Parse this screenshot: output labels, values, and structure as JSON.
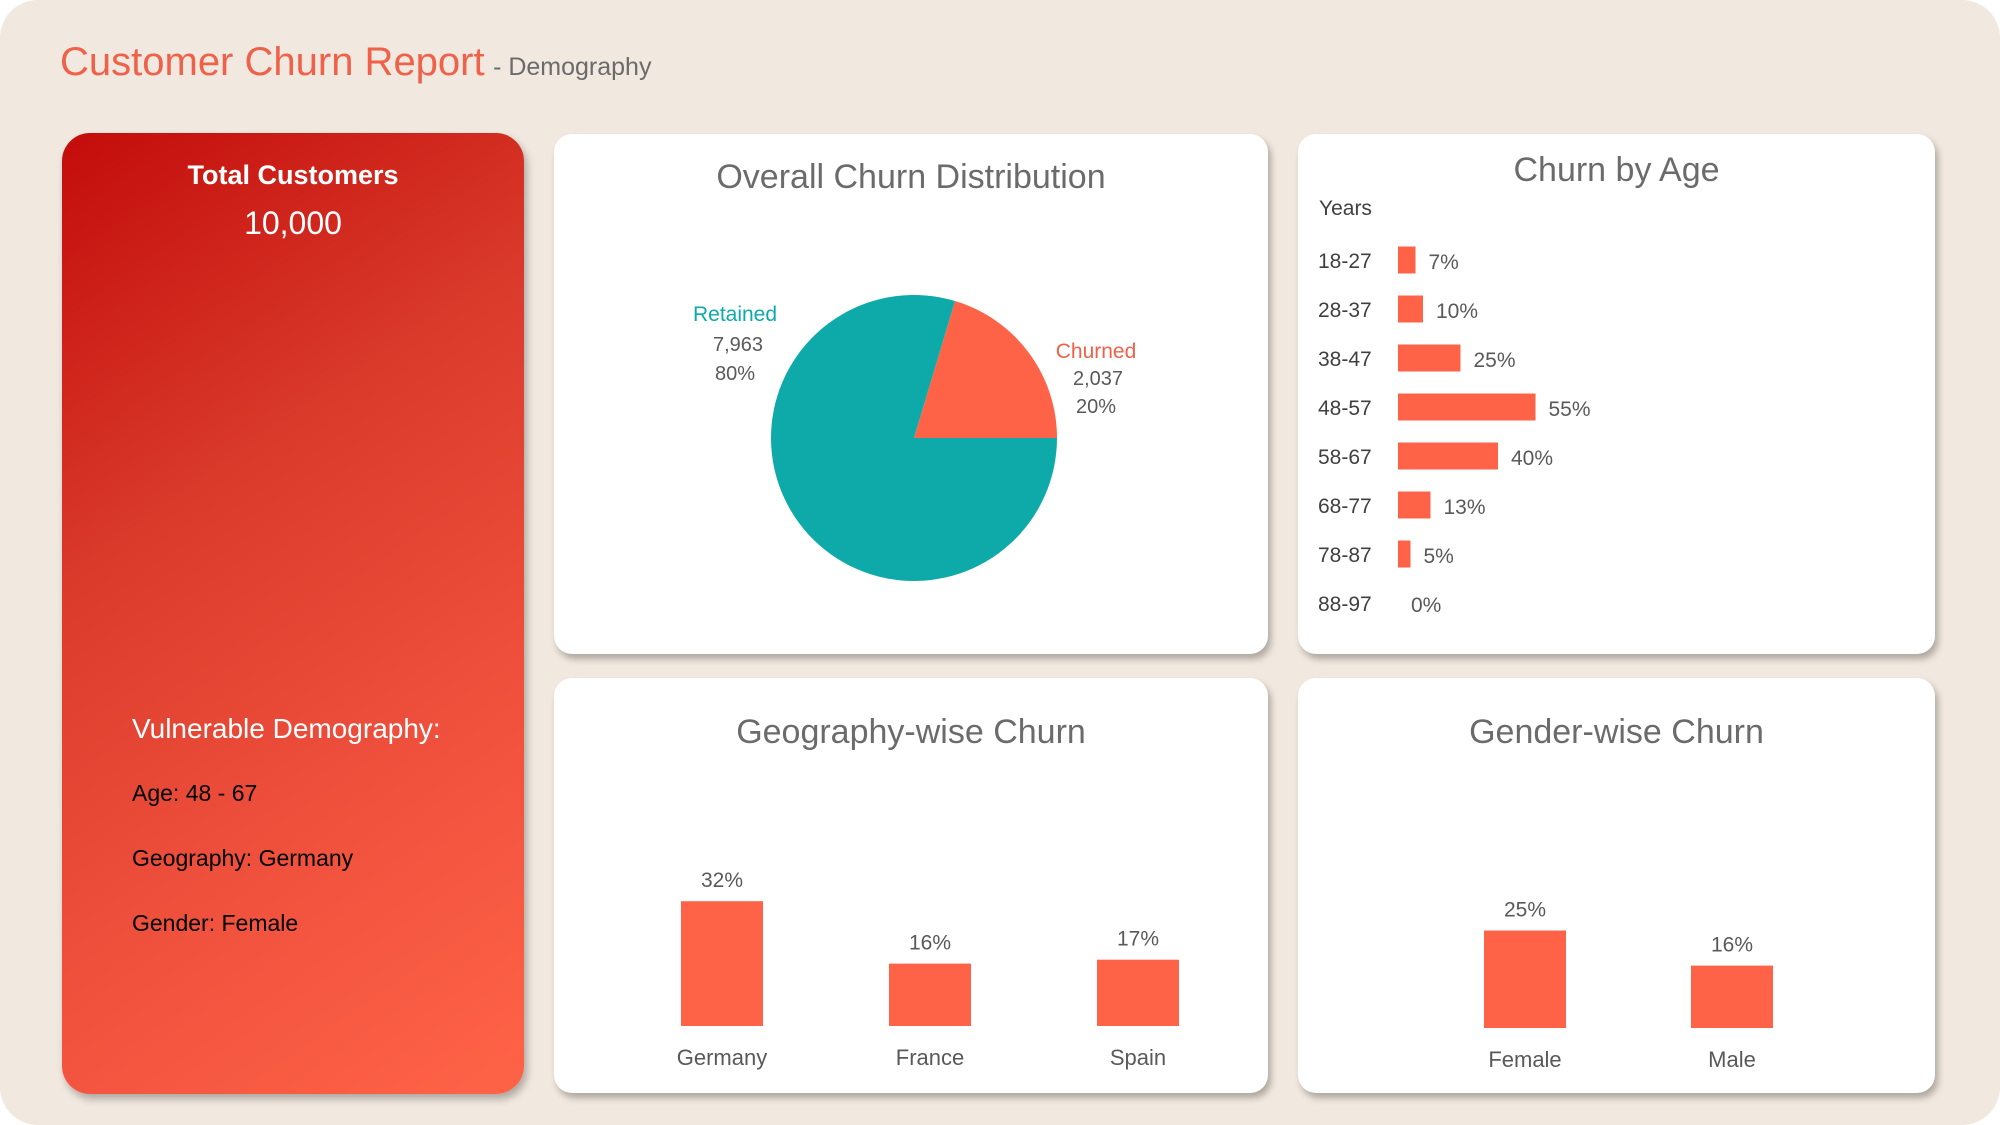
{
  "header": {
    "title": "Customer Churn Report",
    "subtitle": "- Demography"
  },
  "kpi": {
    "label": "Total Customers",
    "value": "10,000",
    "vulnerable_title": "Vulnerable Demography:",
    "age": "Age: 48 - 67",
    "geography": "Geography: Germany",
    "gender": "Gender: Female"
  },
  "colors": {
    "accent": "#FF6347",
    "retained": "#0EAAAA",
    "panel_dark": "#C30C0B",
    "background": "#F1E8DF",
    "text_grey": "#6B6B6B"
  },
  "chart_data": [
    {
      "type": "pie",
      "title": "Overall Churn Distribution",
      "slices": [
        {
          "name": "Churned",
          "value": 2037,
          "count_label": "2,037",
          "percent_label": "20%",
          "color": "#FF6347"
        },
        {
          "name": "Retained",
          "value": 7963,
          "count_label": "7,963",
          "percent_label": "80%",
          "color": "#0EAAAA"
        }
      ]
    },
    {
      "type": "bar",
      "orientation": "horizontal",
      "title": "Churn by Age",
      "ylabel": "Years",
      "categories": [
        "18-27",
        "28-37",
        "38-47",
        "48-57",
        "58-67",
        "68-77",
        "78-87",
        "88-97"
      ],
      "values": [
        7,
        10,
        25,
        55,
        40,
        13,
        5,
        0
      ],
      "value_labels": [
        "7%",
        "10%",
        "25%",
        "55%",
        "40%",
        "13%",
        "5%",
        "0%"
      ],
      "color": "#FF6347"
    },
    {
      "type": "bar",
      "title": "Geography-wise Churn",
      "categories": [
        "Germany",
        "France",
        "Spain"
      ],
      "values": [
        32,
        16,
        17
      ],
      "value_labels": [
        "32%",
        "16%",
        "17%"
      ],
      "color": "#FF6347"
    },
    {
      "type": "bar",
      "title": "Gender-wise Churn",
      "categories": [
        "Female",
        "Male"
      ],
      "values": [
        25,
        16
      ],
      "value_labels": [
        "25%",
        "16%"
      ],
      "color": "#FF6347"
    }
  ]
}
